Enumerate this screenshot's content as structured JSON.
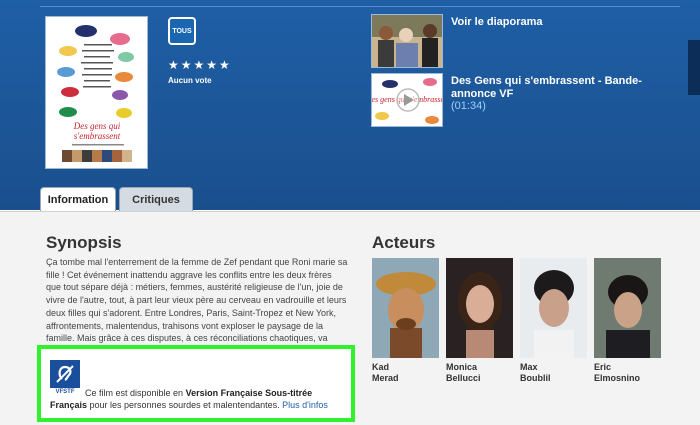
{
  "movie": {
    "rating_badge": "TOUS",
    "stars": "★★★★★",
    "vote_label": "Aucun vote",
    "poster_title_lines": [
      "Des gens qui",
      "s'embrassent"
    ]
  },
  "media": [
    {
      "title": "Voir le diaporama"
    },
    {
      "title": "Des Gens qui s'embrassent - Bande-annonce VF",
      "duration": "(01:34)",
      "thumb_caption": "Des gens qui s'embrassent"
    }
  ],
  "tabs": [
    {
      "label": "Information",
      "active": true
    },
    {
      "label": "Critiques",
      "active": false
    }
  ],
  "synopsis": {
    "heading": "Synopsis",
    "text": "Ça tombe mal l'enterrement de la femme de Zef pendant que Roni marie sa fille ! Cet événement inattendu aggrave les conflits entre les deux frères que tout sépare déjà : métiers, femmes, austérité religieuse de l'un, joie de vivre de l'autre, tout, à part leur vieux père au cerveau en vadrouille et leurs deux filles qui s'adorent. Entre Londres, Paris, Saint-Tropez et New York, affrontements, malentendus, trahisons vont exploser le paysage de la famille. Mais grâce à ces disputes, à ces réconciliations chaotiques, va naître une grande histoire d'amour... et peut-être deux."
  },
  "accessibility": {
    "badge": "VFSTF",
    "text_before": "Ce film est disponible en ",
    "text_bold": "Version Française Sous-titrée Français",
    "text_after": " pour les personnes sourdes et malentendantes.",
    "link": "Plus d'infos"
  },
  "actors": {
    "heading": "Acteurs",
    "list": [
      {
        "first": "Kad",
        "last": "Merad"
      },
      {
        "first": "Monica",
        "last": "Bellucci"
      },
      {
        "first": "Max",
        "last": "Boublil"
      },
      {
        "first": "Eric",
        "last": "Elmosnino"
      }
    ]
  },
  "colors": {
    "accent": "#1f5fa6",
    "highlight_border": "#31f12c",
    "link": "#1f5ea8"
  }
}
